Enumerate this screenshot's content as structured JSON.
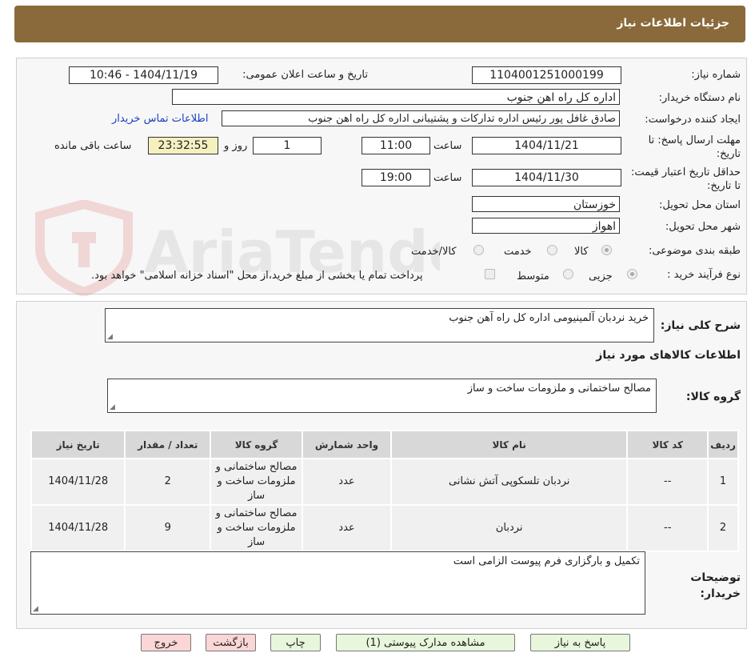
{
  "header": {
    "title": "جزئیات اطلاعات نیاز"
  },
  "fields": {
    "need_number": {
      "label": "شماره نیاز:",
      "value": "1104001251000199"
    },
    "announce_datetime": {
      "label": "تاریخ و ساعت اعلان عمومی:",
      "value": "1404/11/19 - 10:46"
    },
    "buyer_org": {
      "label": "نام دستگاه خریدار:",
      "value": "اداره کل راه اهن جنوب"
    },
    "requester": {
      "label": "ایجاد کننده درخواست:",
      "value": "صادق غافل پور رئیس اداره تدارکات و پشتیبانی اداره کل راه اهن جنوب"
    },
    "contact_link": "اطلاعات تماس خریدار",
    "reply_deadline": {
      "label": "مهلت ارسال پاسخ: تا تاریخ:",
      "date": "1404/11/21",
      "time_label": "ساعت",
      "time": "11:00",
      "days": "1",
      "days_label": "روز و",
      "remaining": "23:32:55",
      "remaining_label": "ساعت باقی مانده"
    },
    "price_validity": {
      "label": "حداقل تاریخ اعتبار قیمت: تا تاریخ:",
      "date": "1404/11/30",
      "time_label": "ساعت",
      "time": "19:00"
    },
    "province": {
      "label": "استان محل تحویل:",
      "value": "خوزستان"
    },
    "city": {
      "label": "شهر محل تحویل:",
      "value": "اهواز"
    },
    "category": {
      "label": "طبقه بندی موضوعی:",
      "options": [
        "کالا",
        "خدمت",
        "کالا/خدمت"
      ]
    },
    "purchase_type": {
      "label": "نوع فرآیند خرید :",
      "options": [
        "جزیی",
        "متوسط"
      ],
      "note": "پرداخت تمام یا بخشی از مبلغ خرید،از محل \"اسناد خزانه اسلامی\" خواهد بود."
    }
  },
  "summary": {
    "label": "شرح کلی نیاز:",
    "value": "خرید نردبان آلمینیومی اداره کل راه آهن جنوب"
  },
  "goods_info_title": "اطلاعات کالاهای مورد نیاز",
  "goods_group": {
    "label": "گروه کالا:",
    "value": "مصالح ساختمانی و ملزومات ساخت و ساز"
  },
  "table": {
    "headers": [
      "ردیف",
      "کد کالا",
      "نام کالا",
      "واحد شمارش",
      "گروه کالا",
      "تعداد / مقدار",
      "تاریخ نیاز"
    ],
    "rows": [
      [
        "1",
        "--",
        "نردبان تلسکوپی آتش نشانی",
        "عدد",
        "مصالح ساختمانی و ملزومات ساخت و ساز",
        "2",
        "1404/11/28"
      ],
      [
        "2",
        "--",
        "نردبان",
        "عدد",
        "مصالح ساختمانی و ملزومات ساخت و ساز",
        "9",
        "1404/11/28"
      ]
    ]
  },
  "buyer_notes": {
    "label": "توضیحات خریدار:",
    "value": "تکمیل و بارگزاری فرم پیوست الزامی است"
  },
  "buttons": {
    "reply": "پاسخ به نیاز",
    "attachments": "مشاهده مدارک پیوستی (1)",
    "print": "چاپ",
    "back": "بازگشت",
    "exit": "خروج"
  },
  "watermark": "AriaTender.neT",
  "colors": {
    "header_bg": "#8a6a3a",
    "button_green": "#e8f6dc",
    "button_pink": "#fbd6d6",
    "link": "#1a3fbf"
  }
}
